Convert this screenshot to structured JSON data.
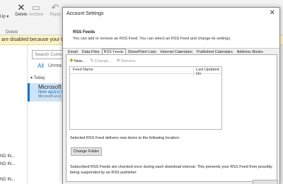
{
  "ribbon": {
    "up_label": "Up",
    "delete_label": "Delete",
    "archive_label": "Archive",
    "reply_label": "Reply",
    "delete_group_label": "Delete"
  },
  "notification": "are disabled because your Office",
  "mail": {
    "search_placeholder": "Search Current",
    "tab_all": "All",
    "tab_unread": "Unrea",
    "group_today": "Today",
    "item": {
      "from": "Microsoft a",
      "subject": "New app(s) co",
      "preview": "Microsoft acco"
    },
    "truncated_rows": [
      "ND IN...",
      "ND IN...",
      "ND IN..."
    ]
  },
  "dialog": {
    "title": "Account Settings",
    "close_glyph": "✕",
    "section_title": "RSS Feeds",
    "section_desc": "You can add or remove an RSS Feed. You can select an RSS Feed and change its settings.",
    "tabs": [
      "Email",
      "Data Files",
      "RSS Feeds",
      "SharePoint Lists",
      "Internet Calendars",
      "Published Calendars",
      "Address Books"
    ],
    "active_tab": "RSS Feeds",
    "toolbar": {
      "new_label": "New...",
      "change_label": "Change...",
      "remove_label": "Remove"
    },
    "list_columns": {
      "name": "Feed Name",
      "updated": "Last Updated On"
    },
    "deliver_text": "Selected RSS Feed delivers new items to the following location:",
    "change_folder_label": "Change Folder",
    "subscription_text": "Subscribed RSS Feeds are checked once during each download interval. This prevents your RSS Feed from possibly being suspended by an RSS publisher."
  },
  "icons": {
    "new": "new-feed-icon",
    "change": "change-feed-icon",
    "remove": "remove-icon",
    "close": "close-icon",
    "delete": "delete-x-icon"
  }
}
